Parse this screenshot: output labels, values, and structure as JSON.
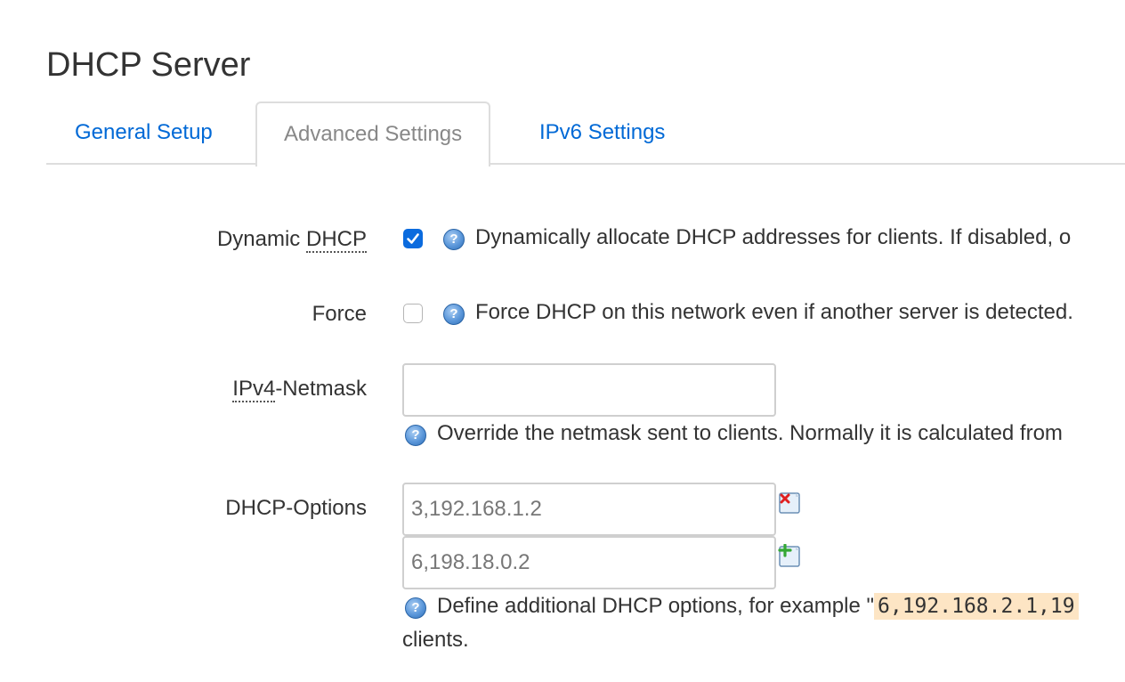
{
  "page": {
    "title": "DHCP Server"
  },
  "tabs": [
    {
      "label": "General Setup"
    },
    {
      "label": "Advanced Settings"
    },
    {
      "label": "IPv6 Settings"
    }
  ],
  "form": {
    "dynamic_dhcp": {
      "label_prefix": "Dynamic ",
      "label_abbr": "DHCP",
      "checked": true,
      "description": "Dynamically allocate DHCP addresses for clients. If disabled, o"
    },
    "force": {
      "label": "Force",
      "checked": false,
      "description": "Force DHCP on this network even if another server is detected."
    },
    "ipv4_netmask": {
      "label_abbr": "IPv4",
      "label_suffix": "-Netmask",
      "value": "",
      "description": "Override the netmask sent to clients. Normally it is calculated from"
    },
    "dhcp_options": {
      "label": "DHCP-Options",
      "values": [
        "3,192.168.1.2",
        "6,198.18.0.2"
      ],
      "description_prefix": "Define additional DHCP options, for example \"",
      "example": "6,192.168.2.1,19",
      "description_line2": "clients."
    }
  },
  "colors": {
    "link": "#0069d6",
    "checkbox_checked": "#0b6bde",
    "example_bg": "#fde5c4"
  },
  "icons": {
    "help": "help-icon",
    "remove": "remove-value-icon",
    "add": "add-value-icon"
  }
}
